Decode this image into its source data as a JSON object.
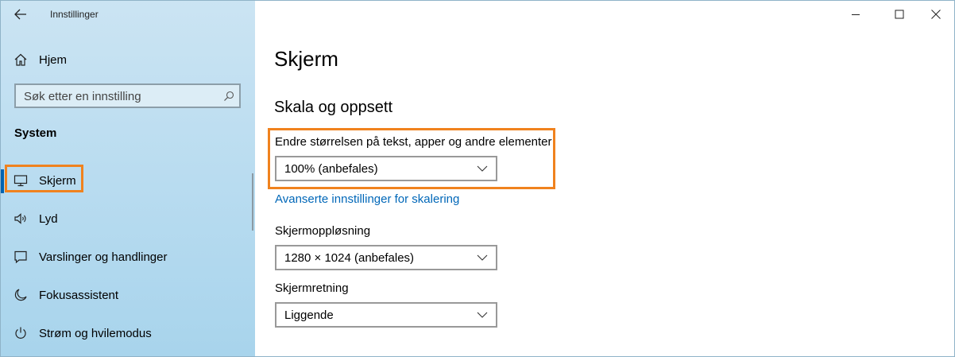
{
  "window": {
    "title": "Innstillinger"
  },
  "sidebar": {
    "home_label": "Hjem",
    "search_placeholder": "Søk etter en innstilling",
    "section_title": "System",
    "items": [
      {
        "label": "Skjerm",
        "icon": "monitor-icon",
        "active": true
      },
      {
        "label": "Lyd",
        "icon": "speaker-icon"
      },
      {
        "label": "Varslinger og handlinger",
        "icon": "notification-icon"
      },
      {
        "label": "Fokusassistent",
        "icon": "moon-icon"
      },
      {
        "label": "Strøm og hvilemodus",
        "icon": "power-icon"
      }
    ]
  },
  "main": {
    "page_title": "Skjerm",
    "section_title": "Skala og oppsett",
    "scale": {
      "label": "Endre størrelsen på tekst, apper og andre elementer",
      "value": "100% (anbefales)"
    },
    "advanced_link": "Avanserte innstillinger for skalering",
    "resolution": {
      "label": "Skjermoppløsning",
      "value": "1280 × 1024 (anbefales)"
    },
    "orientation": {
      "label": "Skjermretning",
      "value": "Liggende"
    }
  },
  "colors": {
    "highlight": "#f0821e",
    "accent": "#0063b1",
    "link": "#0067b8"
  }
}
